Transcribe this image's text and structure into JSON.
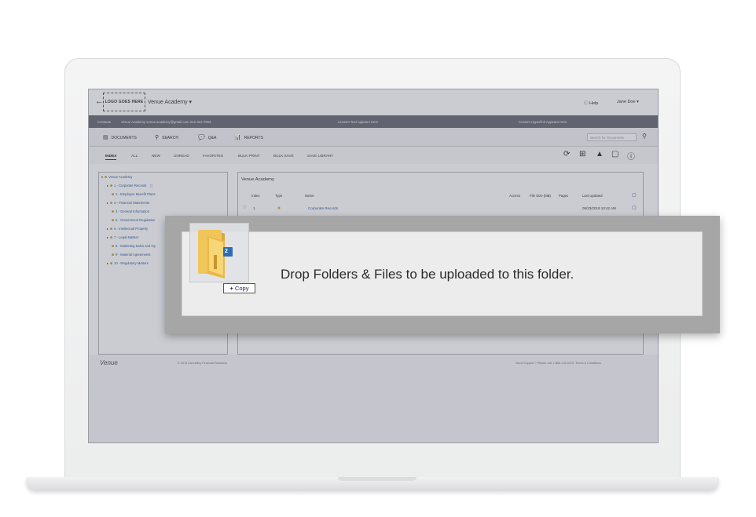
{
  "header": {
    "back_label": "←",
    "logo_text": "LOGO GOES HERE",
    "academy_name": "Venue Academy ▾",
    "help_label": "ⓘ Help",
    "user_label": "Jane Doe ▾"
  },
  "info_bar": {
    "contacts_label": "Contacts",
    "contact_details": "Venue Academy   venue.academy@gmail.com   212-341-7653",
    "custom_text": "Custom Text Appears Here",
    "custom_link": "Custom Hyperlink Appears Here"
  },
  "nav": {
    "documents": "DOCUMENTS",
    "search": "SEARCH",
    "qa": "Q&A",
    "reports": "REPORTS",
    "search_placeholder": "Search for Documents"
  },
  "filters": [
    "INDEX",
    "ALL",
    "NEW",
    "UNREAD",
    "FAVORITES",
    "BULK PRINT",
    "BULK SAVE",
    "SAVE LIBRARY"
  ],
  "tree": {
    "root": "Venue Academy",
    "items": [
      "1 - Corporate Records",
      "2 - Employee Benefit Plans",
      "3 - Financial Statements",
      "4 - General Information",
      "5 - Government Regulation",
      "6 - Intellectual Property",
      "7 - Legal Matters",
      "8 - Marketing Sales and Op",
      "9 - Material Agreements",
      "10 - Regulatory Matters"
    ]
  },
  "content": {
    "title": "Venue Academy",
    "columns": {
      "index": "Index",
      "type": "Type",
      "name": "Name",
      "access": "Access",
      "file_size": "File Size (MB)",
      "pages": "Pages",
      "last_updated": "Last Updated"
    },
    "row": {
      "index": "1",
      "name": "Corporate Records",
      "last_updated": "05/23/2019 10:42 AM"
    }
  },
  "footer": {
    "logo": "Venue",
    "copyright": "© 2019 Donnelley Financial Solutions",
    "support": "Need Support ? Please call 1-888-715-5379. Terms & Conditions"
  },
  "drop": {
    "message": "Drop Folders & Files to be uploaded to this folder.",
    "copy_label": "Copy",
    "copy_plus": "+",
    "file_count": "2"
  },
  "colors": {
    "info_bar": "#6d6f78",
    "link": "#2c5f9e",
    "folder": "#e8b94a"
  }
}
